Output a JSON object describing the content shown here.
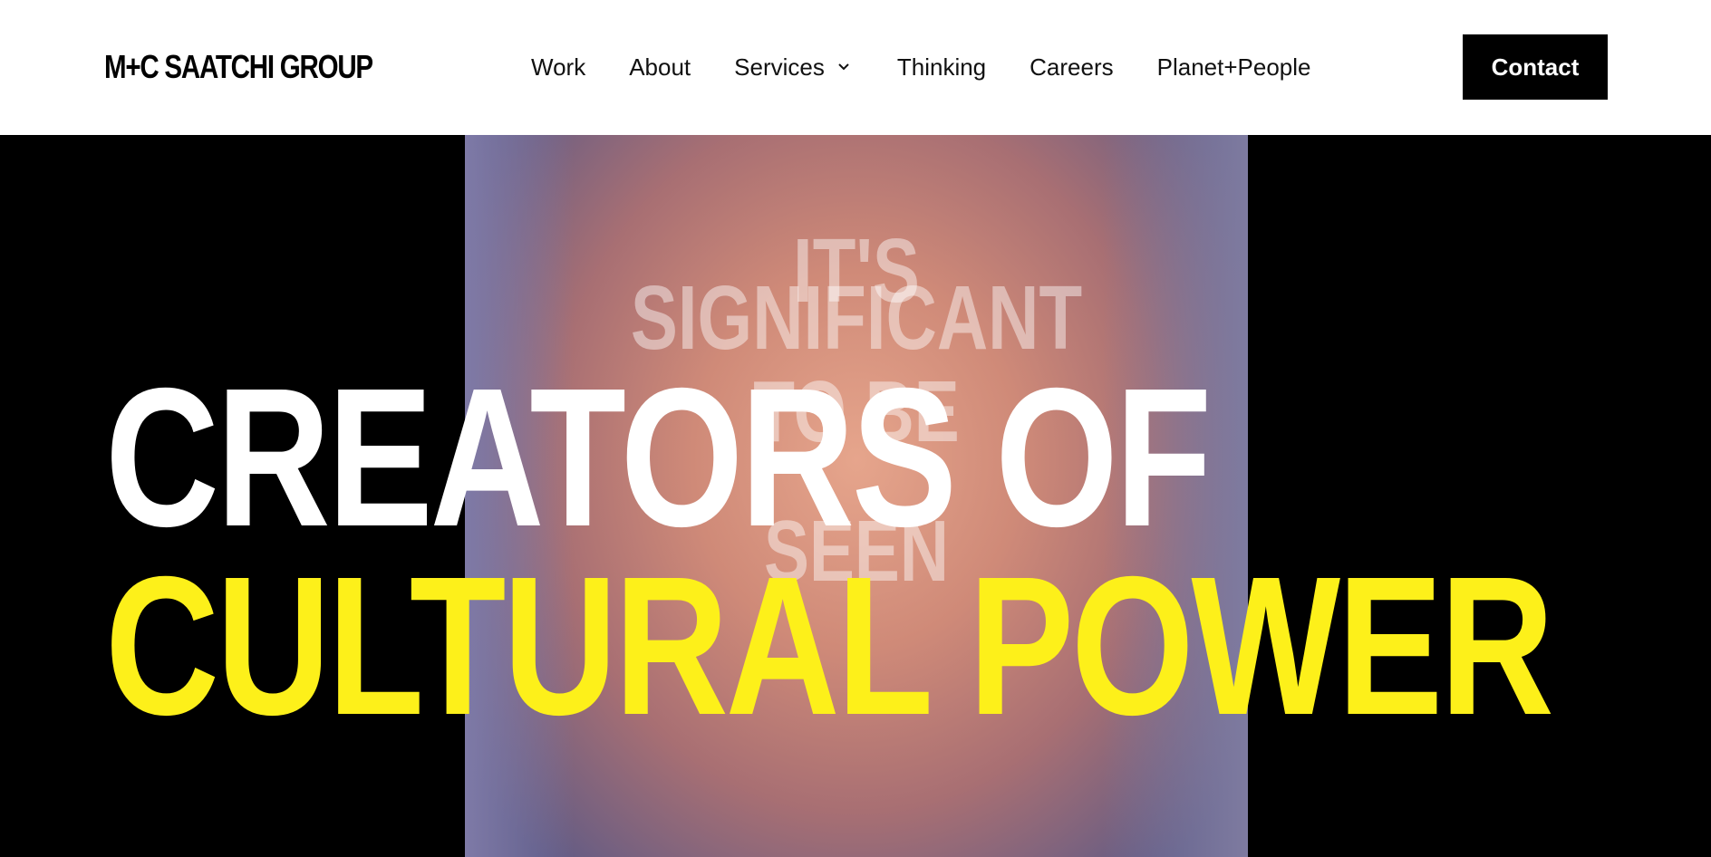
{
  "brand": {
    "logo_text": "M+C SAATCHI GROUP"
  },
  "nav": {
    "items": [
      {
        "label": "Work"
      },
      {
        "label": "About"
      },
      {
        "label": "Services"
      },
      {
        "label": "Thinking"
      },
      {
        "label": "Careers"
      },
      {
        "label": "Planet+People"
      }
    ],
    "services_icon": "chevron-down-icon"
  },
  "header": {
    "contact_label": "Contact"
  },
  "hero": {
    "line1": "CREATORS OF",
    "line2": "CULTURAL POWER",
    "video_text": {
      "line1": "IT'S",
      "line2": "SIGNIFICANT",
      "line3": "TO BE",
      "line4": "SEEN"
    }
  },
  "colors": {
    "accent_yellow": "#fdf01a",
    "header_bg": "#ffffff",
    "hero_bg": "#000000",
    "button_bg": "#000000",
    "button_text": "#ffffff"
  }
}
